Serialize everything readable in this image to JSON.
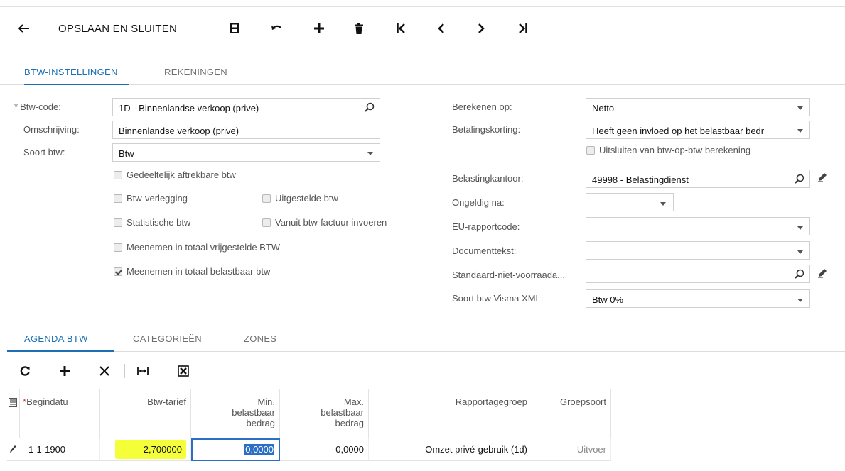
{
  "toolbar": {
    "save_close": "OPSLAAN EN SLUITEN",
    "icons": [
      "back-arrow-icon",
      "save-icon",
      "undo-icon",
      "add-icon",
      "delete-icon",
      "first-icon",
      "prev-icon",
      "next-icon",
      "last-icon"
    ]
  },
  "tabs": [
    "BTW-INSTELLINGEN",
    "REKENINGEN"
  ],
  "form": {
    "btw_code": {
      "required": "*",
      "label": "Btw-code:",
      "value": "1D - Binnenlandse verkoop (prive)"
    },
    "omschrijving": {
      "label": "Omschrijving:",
      "value": "Binnenlandse verkoop (prive)"
    },
    "soort_btw": {
      "label": "Soort btw:",
      "value": "Btw"
    },
    "checkboxes": {
      "gedeeltelijk": {
        "label": "Gedeeltelijk aftrekbare btw",
        "checked": false
      },
      "verlegging": {
        "label": "Btw-verlegging",
        "checked": false
      },
      "uitgesteld": {
        "label": "Uitgestelde btw",
        "checked": false
      },
      "statistisch": {
        "label": "Statistische btw",
        "checked": false
      },
      "vanuit_factuur": {
        "label": "Vanuit btw-factuur invoeren",
        "checked": false
      },
      "vrijgesteld": {
        "label": "Meenemen in totaal vrijgestelde BTW",
        "checked": false
      },
      "belastbaar": {
        "label": "Meenemen in totaal belastbaar btw",
        "checked": true
      }
    },
    "berekenen_op": {
      "label": "Berekenen op:",
      "value": "Netto"
    },
    "betalingskorting": {
      "label": "Betalingskorting:",
      "value": "Heeft geen invloed op het belastbaar bedr"
    },
    "uitsluiten": {
      "label": "Uitsluiten van btw-op-btw berekening",
      "checked": false
    },
    "belastingkantoor": {
      "label": "Belastingkantoor:",
      "value": "49998 - Belastingdienst"
    },
    "ongeldig_na": {
      "label": "Ongeldig na:",
      "value": ""
    },
    "eu_rapportcode": {
      "label": "EU-rapportcode:",
      "value": ""
    },
    "documenttekst": {
      "label": "Documenttekst:",
      "value": ""
    },
    "standaard": {
      "label": "Standaard-niet-voorraada...",
      "value": ""
    },
    "soort_visma": {
      "label": "Soort btw Visma XML:",
      "value": "Btw 0%"
    }
  },
  "lower_tabs": [
    "AGENDA BTW",
    "CATEGORIEËN",
    "ZONES"
  ],
  "grid": {
    "headers": {
      "begindatum": "Begindatu",
      "begindatum_req": "*",
      "tarief": "Btw-tarief",
      "min": [
        "Min.",
        "belastbaar",
        "bedrag"
      ],
      "max": [
        "Max.",
        "belastbaar",
        "bedrag"
      ],
      "rapportage": "Rapportagegroep",
      "groepsoort": "Groepsoort"
    },
    "rows": [
      {
        "begindatum": "1-1-1900",
        "tarief": "2,700000",
        "min": "0,0000",
        "max": "0,0000",
        "rapportage": "Omzet privé-gebruik (1d)",
        "groepsoort": "Uitvoer"
      }
    ]
  },
  "colors": {
    "accent": "#1c6fb5",
    "highlight": "#f4ff3a"
  }
}
